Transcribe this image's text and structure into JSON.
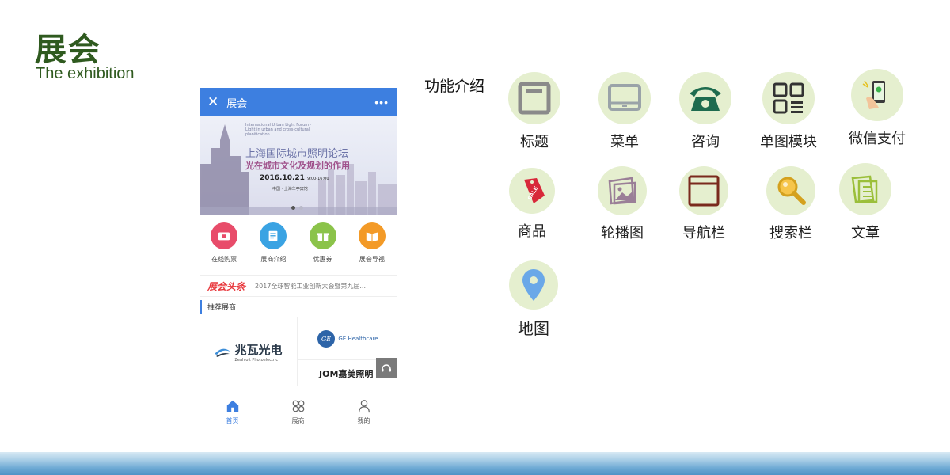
{
  "slide": {
    "title": "展会",
    "subtitle": "The exhibition"
  },
  "phone": {
    "header": {
      "close": "✕",
      "title": "展会",
      "more": "•••"
    },
    "banner": {
      "line1": "International Urban Light Forum · Light in urban and cross-cultural planification",
      "title": "上海国际城市照明论坛",
      "subtitle": "光在城市文化及规划的作用",
      "date": "2016.10.21",
      "time": "9:00-16:00",
      "place": "中国 · 上海华亭宾馆"
    },
    "quick_links": [
      {
        "label": "在线购票",
        "color": "#e84c6a",
        "icon": "ticket-icon"
      },
      {
        "label": "展商介绍",
        "color": "#3aa3e3",
        "icon": "document-icon"
      },
      {
        "label": "优惠券",
        "color": "#8bc34a",
        "icon": "gift-icon"
      },
      {
        "label": "展会导视",
        "color": "#f39a27",
        "icon": "book-icon"
      }
    ],
    "headline": {
      "brand": "展会头条",
      "news": "2017全球智能工业创新大会暨第九届..."
    },
    "section_title": "推荐展商",
    "exhibitors": [
      {
        "name": "兆瓦光电",
        "sub": "Zealvolt Photoelectric"
      },
      {
        "name": "GE Healthcare"
      },
      {
        "name": "JOM嘉美照明"
      }
    ],
    "tabs": [
      {
        "label": "首页",
        "icon": "home-icon"
      },
      {
        "label": "展商",
        "icon": "grid-icon"
      },
      {
        "label": "我的",
        "icon": "person-icon"
      }
    ]
  },
  "features": {
    "label": "功能介绍",
    "items": [
      {
        "label": "标题",
        "icon": "title-icon"
      },
      {
        "label": "菜单",
        "icon": "menu-icon"
      },
      {
        "label": "咨询",
        "icon": "phone-icon"
      },
      {
        "label": "单图模块",
        "icon": "layout-icon"
      },
      {
        "label": "微信支付",
        "icon": "wechat-pay-icon"
      },
      {
        "label": "商品",
        "icon": "sale-tag-icon"
      },
      {
        "label": "轮播图",
        "icon": "carousel-icon"
      },
      {
        "label": "导航栏",
        "icon": "navbar-icon"
      },
      {
        "label": "搜索栏",
        "icon": "search-icon"
      },
      {
        "label": "文章",
        "icon": "article-icon"
      },
      {
        "label": "地图",
        "icon": "map-pin-icon"
      }
    ]
  }
}
